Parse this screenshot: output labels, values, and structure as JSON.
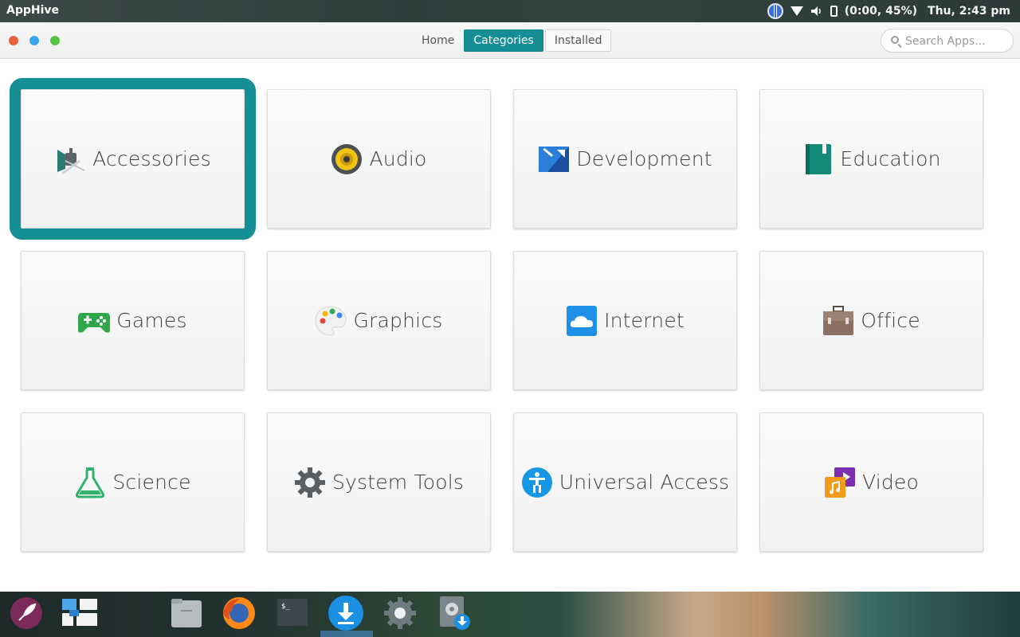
{
  "panel": {
    "app_name": "AppHive",
    "battery_text": "(0:00, 45%)",
    "clock": "Thu,  2:43 pm"
  },
  "window": {
    "nav": {
      "home": "Home",
      "categories": "Categories",
      "installed": "Installed",
      "active": "Categories"
    },
    "search": {
      "placeholder": "Search Apps..."
    }
  },
  "categories": [
    {
      "label": "Accessories",
      "icon": "accessories-icon",
      "selected": true
    },
    {
      "label": "Audio",
      "icon": "speaker-icon"
    },
    {
      "label": "Development",
      "icon": "development-icon"
    },
    {
      "label": "Education",
      "icon": "book-icon"
    },
    {
      "label": "Games",
      "icon": "gamepad-icon"
    },
    {
      "label": "Graphics",
      "icon": "palette-icon"
    },
    {
      "label": "Internet",
      "icon": "cloud-icon"
    },
    {
      "label": "Office",
      "icon": "briefcase-icon"
    },
    {
      "label": "Science",
      "icon": "flask-icon"
    },
    {
      "label": "System Tools",
      "icon": "gear-icon"
    },
    {
      "label": "Universal Access",
      "icon": "accessibility-icon"
    },
    {
      "label": "Video",
      "icon": "video-music-icon"
    }
  ],
  "colors": {
    "accent": "#168e96",
    "close": "#e8623d",
    "minimize": "#3aa7e8",
    "maximize": "#58c341"
  },
  "dock": [
    {
      "name": "launcher-icon"
    },
    {
      "name": "multitasking-icon"
    },
    {
      "name": "files-icon"
    },
    {
      "name": "firefox-icon"
    },
    {
      "name": "terminal-icon"
    },
    {
      "name": "apphive-download-icon",
      "active": true
    },
    {
      "name": "settings-icon"
    },
    {
      "name": "software-install-icon"
    }
  ]
}
